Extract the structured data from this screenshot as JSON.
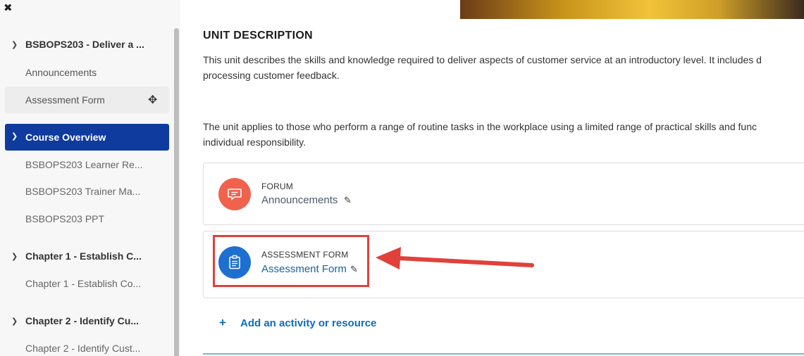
{
  "sidebar": {
    "close_icon": "close-icon",
    "sections": [
      {
        "title": "BSBOPS203 - Deliver a ...",
        "items": [
          "Announcements",
          "Assessment Form"
        ]
      },
      {
        "title": "Course Overview",
        "items": [
          "BSBOPS203 Learner Re...",
          "BSBOPS203 Trainer Ma...",
          "BSBOPS203 PPT"
        ]
      },
      {
        "title": "Chapter 1 - Establish C...",
        "items": [
          "Chapter 1 - Establish Co..."
        ]
      },
      {
        "title": "Chapter 2 - Identify Cu...",
        "items": [
          "Chapter 2 - Identify Cust..."
        ]
      }
    ],
    "active_color": "#0f3a9e"
  },
  "main": {
    "heading": "UNIT DESCRIPTION",
    "para1_line1": "This unit describes the skills and knowledge required to deliver aspects of customer service at an introductory level. It includes d",
    "para1_line2": "processing customer feedback.",
    "para2_line1": "The unit applies to those who perform a range of routine tasks in the workplace using a limited range of practical skills and func",
    "para2_line2": "individual responsibility.",
    "activities": [
      {
        "type": "FORUM",
        "name": "Announcements",
        "icon": "forum-icon",
        "color": "#f0624d"
      },
      {
        "type": "ASSESSMENT FORM",
        "name": "Assessment Form",
        "icon": "clipboard-icon",
        "color": "#1f6fd1"
      }
    ],
    "add_activity": "Add an activity or resource"
  },
  "annotation": {
    "color": "#e0413b"
  }
}
